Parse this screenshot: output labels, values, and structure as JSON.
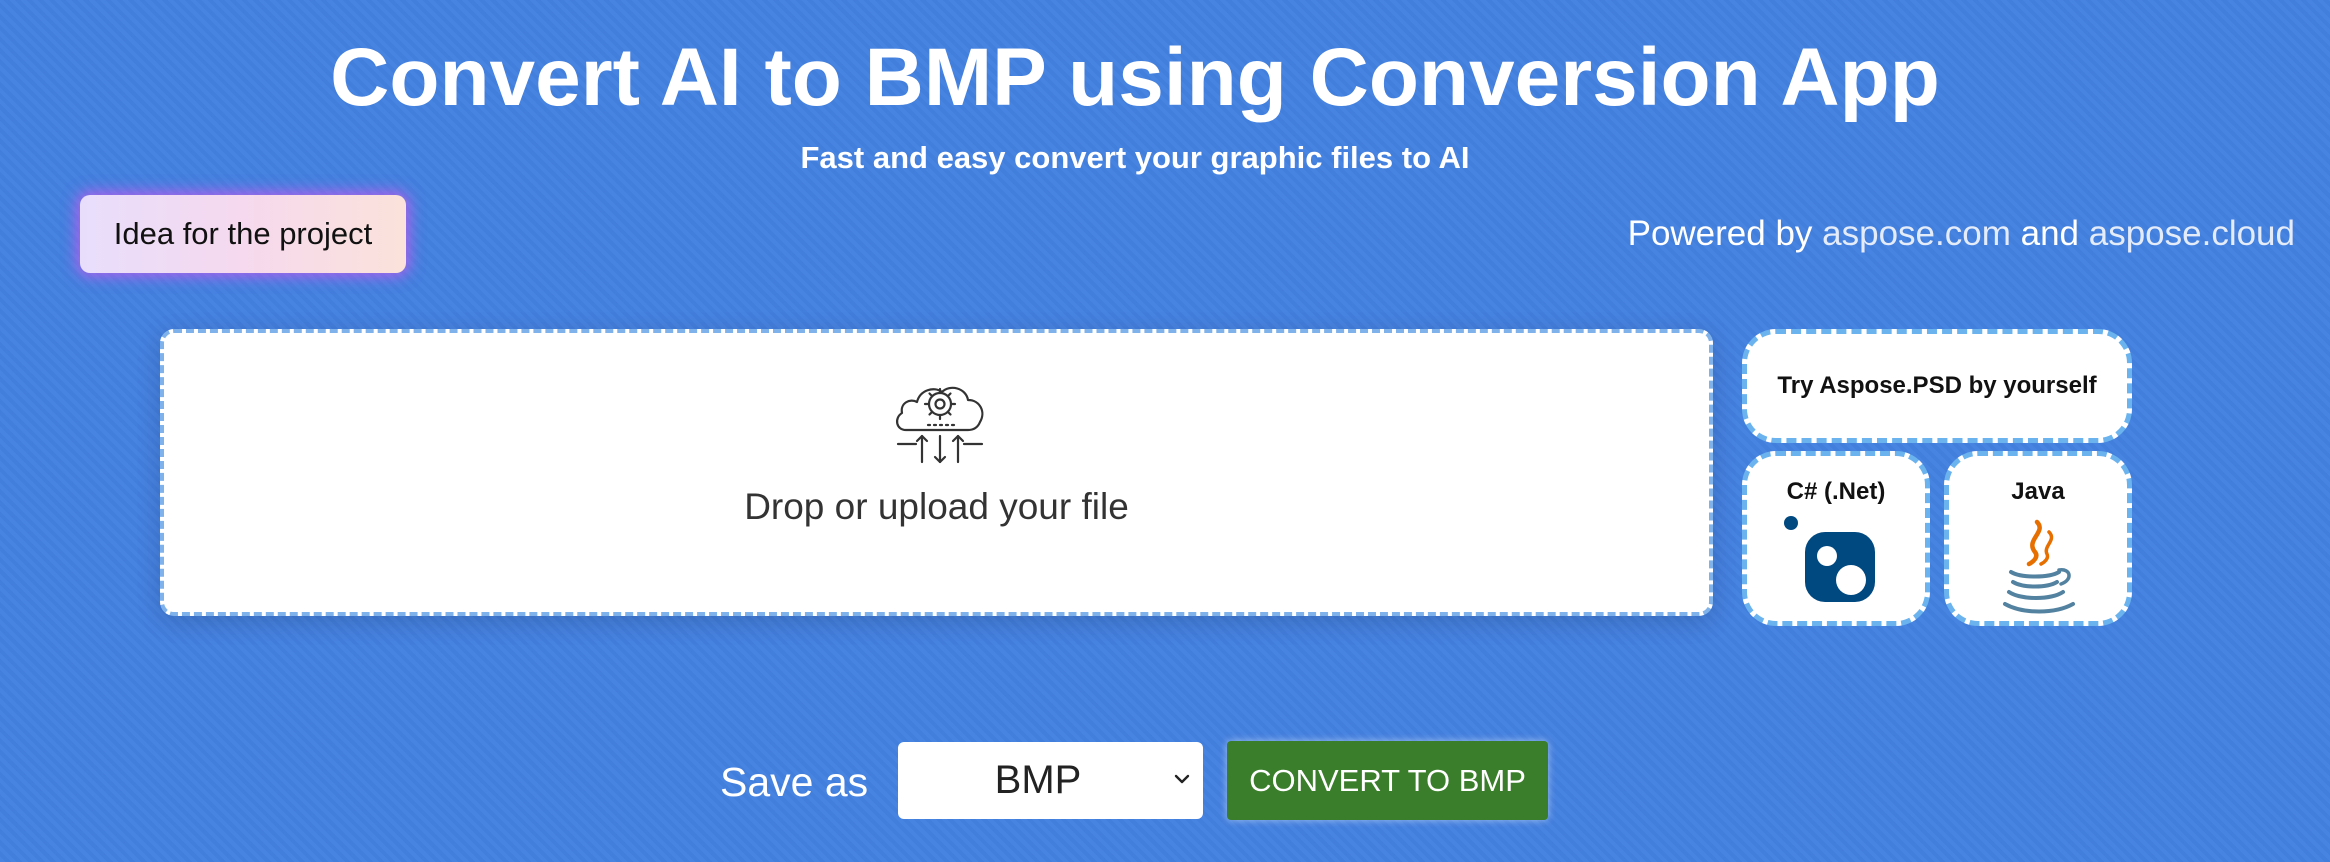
{
  "header": {
    "title": "Convert AI to BMP using Conversion App",
    "subtitle": "Fast and easy convert your graphic files to AI"
  },
  "idea_button": {
    "label": "Idea for the project"
  },
  "powered_by": {
    "prefix": "Powered by ",
    "link1": "aspose.com",
    "middle": " and ",
    "link2": "aspose.cloud"
  },
  "dropzone": {
    "label": "Drop or upload your file",
    "icon": "cloud-upload-gear-icon"
  },
  "side_cards": {
    "try_label": "Try Aspose.PSD by yourself",
    "csharp_label": "C# (.Net)",
    "csharp_icon": "nuget-icon",
    "java_label": "Java",
    "java_icon": "java-coffee-cup-icon"
  },
  "save_form": {
    "label": "Save as",
    "selected_format": "BMP",
    "convert_label": "CONVERT TO BMP"
  },
  "colors": {
    "background": "#4380e0",
    "convert_button": "#3a7d2a",
    "dashed_border": "#6ab3ee",
    "nuget_blue": "#004880",
    "java_orange": "#e76f00",
    "java_blue": "#5382a1"
  }
}
